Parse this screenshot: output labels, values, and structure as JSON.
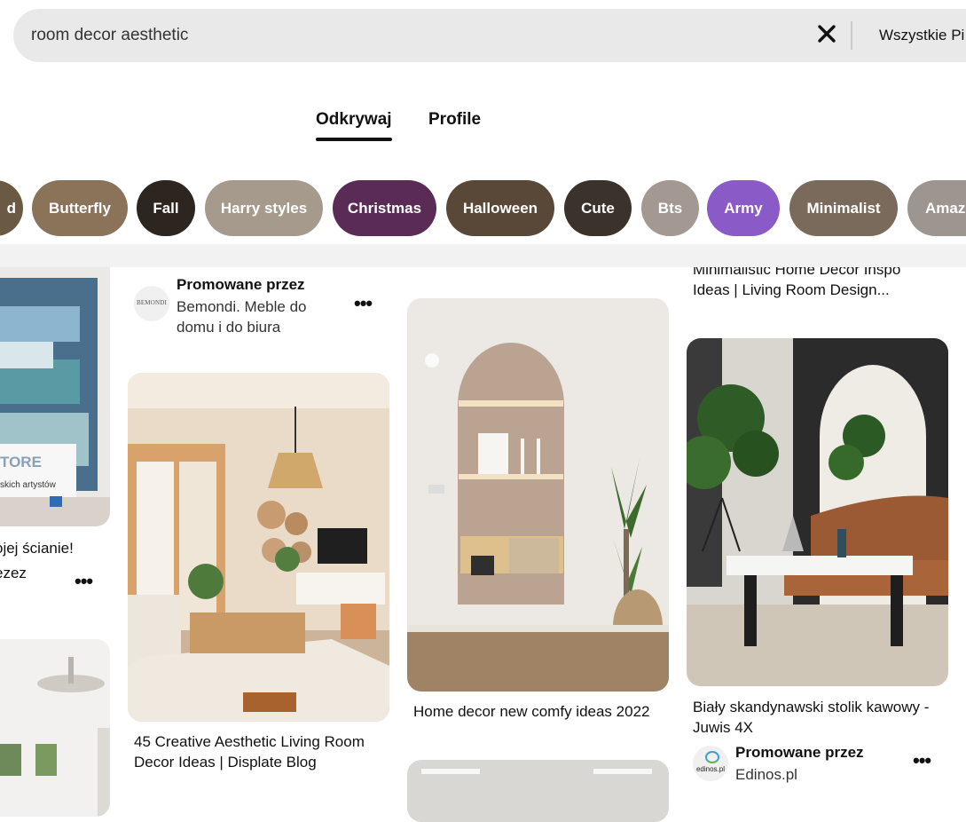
{
  "search": {
    "query": "room decor aesthetic",
    "filter_label": "Wszystkie Pi"
  },
  "tabs": [
    {
      "label": "Odkrywaj",
      "active": true
    },
    {
      "label": "Profile",
      "active": false
    }
  ],
  "chips": [
    {
      "label": "d",
      "color": "#6a5a44"
    },
    {
      "label": "Butterfly",
      "color": "#8b735a"
    },
    {
      "label": "Fall",
      "color": "#2c2520"
    },
    {
      "label": "Harry styles",
      "color": "#a69a8c"
    },
    {
      "label": "Christmas",
      "color": "#5a2b55"
    },
    {
      "label": "Halloween",
      "color": "#594837"
    },
    {
      "label": "Cute",
      "color": "#3a322b"
    },
    {
      "label": "Bts",
      "color": "#a39892"
    },
    {
      "label": "Army",
      "color": "#8a5ac6"
    },
    {
      "label": "Minimalist",
      "color": "#7a6a5c"
    },
    {
      "label": "Amaz",
      "color": "#9d958f"
    }
  ],
  "pins": {
    "col1_text1": "ojej ścianie!",
    "col1_text2": "ezez",
    "col1_overlay_brand": "TORE",
    "col1_overlay_sub": "skich artystów",
    "col2_promo_label": "Promowane przez",
    "col2_promo_name": "Bemondi. Meble do domu i do biura",
    "col2_avatar_text": "BEMONDI",
    "col2_title": "45 Creative Aesthetic Living Room Decor Ideas | Displate Blog",
    "col3_title": "Home decor new comfy ideas 2022",
    "col4_top_partial": "Minimalistic Home Decor Inspo",
    "col4_top_line2": "Ideas | Living Room Design...",
    "col4_title": "Biały skandynawski stolik kawowy - Juwis 4X",
    "col4_promo_label": "Promowane przez",
    "col4_promo_name": "Edinos.pl",
    "col4_avatar_text": "edinos.pl"
  },
  "colors": {
    "search_bg": "#e9e9e9",
    "army_chip": "#8a5ac6",
    "christmas_chip": "#5a2b55"
  }
}
